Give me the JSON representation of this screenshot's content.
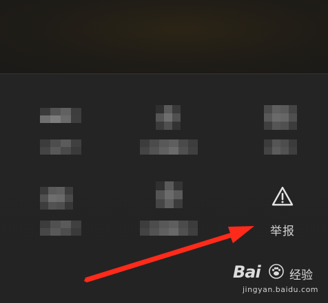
{
  "report": {
    "label": "举报",
    "icon": "warning-triangle-icon"
  },
  "watermark": {
    "logo_text": "Bai",
    "logo_suffix": "经验",
    "url": "jingyan.baidu.com"
  },
  "colors": {
    "background": "#232323",
    "text": "#cfcfcf",
    "annotation_arrow": "#ff2a1a"
  }
}
